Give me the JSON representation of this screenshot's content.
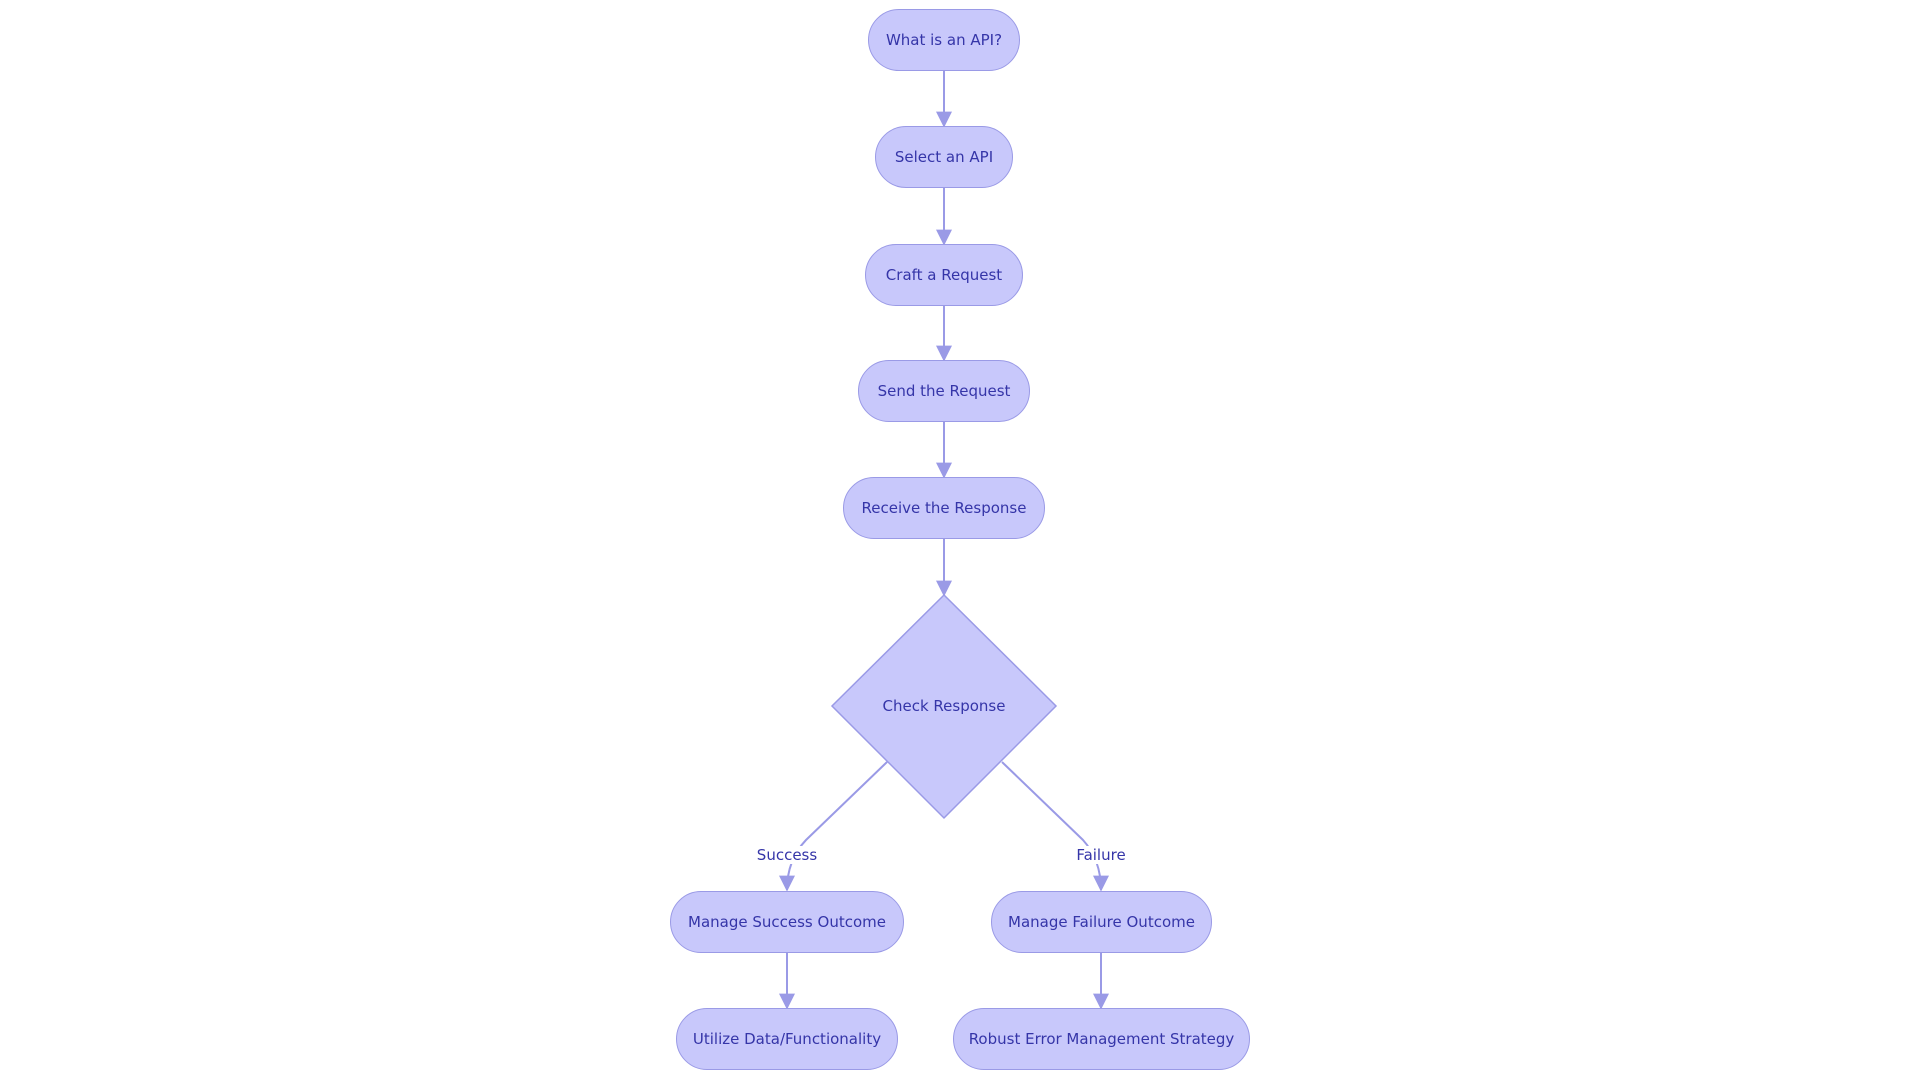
{
  "diagram": {
    "colors": {
      "node_fill": "#c8c8fb",
      "node_stroke": "#9a9ae6",
      "edge": "#9a9ae6",
      "text": "#3535a8"
    },
    "nodes": [
      {
        "id": "what-is-api",
        "label": "What is an API?",
        "shape": "rounded"
      },
      {
        "id": "select-api",
        "label": "Select an API",
        "shape": "rounded"
      },
      {
        "id": "craft-request",
        "label": "Craft a Request",
        "shape": "rounded"
      },
      {
        "id": "send-request",
        "label": "Send the Request",
        "shape": "rounded"
      },
      {
        "id": "receive-response",
        "label": "Receive the Response",
        "shape": "rounded"
      },
      {
        "id": "check-response",
        "label": "Check Response",
        "shape": "diamond"
      },
      {
        "id": "manage-success",
        "label": "Manage Success Outcome",
        "shape": "rounded"
      },
      {
        "id": "manage-failure",
        "label": "Manage Failure Outcome",
        "shape": "rounded"
      },
      {
        "id": "utilize-data",
        "label": "Utilize Data/Functionality",
        "shape": "rounded"
      },
      {
        "id": "robust-error",
        "label": "Robust Error Management Strategy",
        "shape": "rounded"
      }
    ],
    "edges": [
      {
        "from": "what-is-api",
        "to": "select-api"
      },
      {
        "from": "select-api",
        "to": "craft-request"
      },
      {
        "from": "craft-request",
        "to": "send-request"
      },
      {
        "from": "send-request",
        "to": "receive-response"
      },
      {
        "from": "receive-response",
        "to": "check-response"
      },
      {
        "from": "check-response",
        "to": "manage-success",
        "label": "Success"
      },
      {
        "from": "check-response",
        "to": "manage-failure",
        "label": "Failure"
      },
      {
        "from": "manage-success",
        "to": "utilize-data"
      },
      {
        "from": "manage-failure",
        "to": "robust-error"
      }
    ]
  }
}
